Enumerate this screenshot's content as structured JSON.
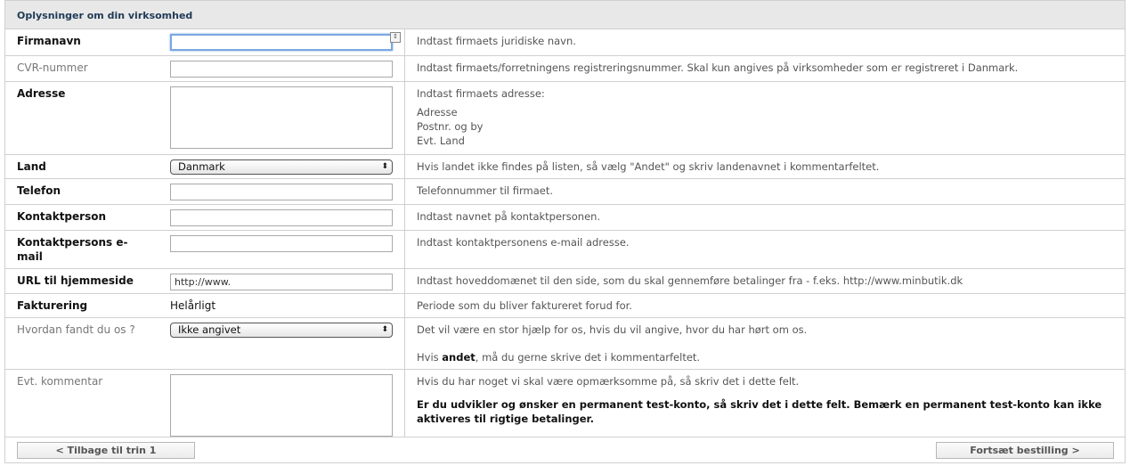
{
  "section_title": "Oplysninger om din virksomhed",
  "rows": {
    "company": {
      "label": "Firmanavn",
      "value": "",
      "help": "Indtast firmaets juridiske navn."
    },
    "cvr": {
      "label": "CVR-nummer",
      "value": "",
      "help": "Indtast firmaets/forretningens registreringsnummer. Skal kun angives på virksomheder som er registreret i Danmark."
    },
    "address": {
      "label": "Adresse",
      "value": "",
      "help_title": "Indtast firmaets adresse:",
      "help_lines": [
        "Adresse",
        "Postnr. og by",
        "Evt. Land"
      ]
    },
    "country": {
      "label": "Land",
      "selected": "Danmark",
      "help": "Hvis landet ikke findes på listen, så vælg \"Andet\" og skriv landenavnet i kommentarfeltet."
    },
    "phone": {
      "label": "Telefon",
      "value": "",
      "help": "Telefonnummer til firmaet."
    },
    "contact": {
      "label": "Kontaktperson",
      "value": "",
      "help": "Indtast navnet på kontaktpersonen."
    },
    "contact_email": {
      "label": "Kontaktpersons e-mail",
      "value": "",
      "help": "Indtast kontaktpersonens e-mail adresse."
    },
    "url": {
      "label": "URL til hjemmeside",
      "value": "http://www.",
      "help": "Indtast hoveddomænet til den side, som du skal gennemføre betalinger fra - f.eks. http://www.minbutik.dk"
    },
    "billing": {
      "label": "Fakturering",
      "value": "Helårligt",
      "help": "Periode som du bliver faktureret forud for."
    },
    "found": {
      "label": "Hvordan fandt du os ?",
      "selected": "Ikke angivet",
      "help1": "Det vil være en stor hjælp for os, hvis du vil angive, hvor du har hørt om os.",
      "help2_pre": "Hvis ",
      "help2_bold": "andet",
      "help2_post": ", må du gerne skrive det i kommentarfeltet."
    },
    "comment": {
      "label": "Evt. kommentar",
      "value": "",
      "help1": "Hvis du har noget vi skal være opmærksomme på, så skriv det i dette felt.",
      "help2": "Er du udvikler og ønsker en permanent test-konto, så skriv det i dette felt. Bemærk en permanent test-konto kan ikke aktiveres til rigtige betalinger."
    }
  },
  "buttons": {
    "back": "< Tilbage til trin 1",
    "next": "Fortsæt bestilling >"
  }
}
